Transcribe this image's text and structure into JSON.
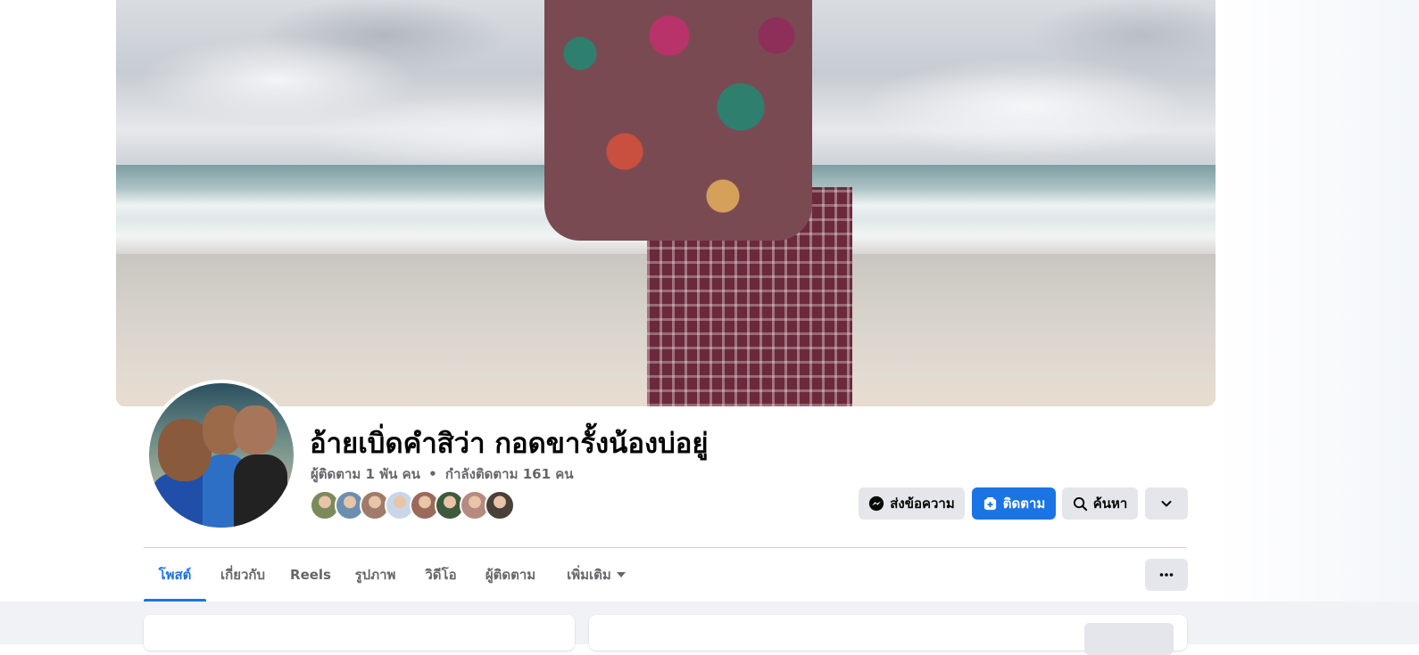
{
  "profile": {
    "name": "อ้ายเบิ่ดคำสิว่า กอดขารั้งน้องบ่อยู่",
    "followers": "ผู้ติดตาม 1 พัน คน",
    "separator": "•",
    "following": "กำลังติดตาม 161 คน"
  },
  "mutual_followers": {
    "colors": [
      "#7a8a5a",
      "#6c8fb0",
      "#a07a6a",
      "#c8d6e8",
      "#9a6a5a",
      "#3d5a3a",
      "#b58a80",
      "#4a4038"
    ]
  },
  "actions": {
    "message_label": "ส่งข้อความ",
    "follow_label": "ติดตาม",
    "search_label": "ค้นหา"
  },
  "tabs": [
    {
      "label": "โพสต์",
      "active": true
    },
    {
      "label": "เกี่ยวกับ",
      "active": false
    },
    {
      "label": "Reels",
      "active": false
    },
    {
      "label": "รูปภาพ",
      "active": false
    },
    {
      "label": "วิดีโอ",
      "active": false
    },
    {
      "label": "ผู้ติดตาม",
      "active": false
    },
    {
      "label": "เพิ่มเติม",
      "active": false
    }
  ],
  "colors": {
    "accent": "#1b74e4",
    "button_gray": "#e4e6eb",
    "secondary_text": "#65676b",
    "feed_bg": "#f0f2f5"
  },
  "icons": {
    "message": "messenger-icon",
    "follow": "follow-icon",
    "search": "search-icon",
    "dropdown": "chevron-down-icon",
    "more": "more-horizontal-icon"
  }
}
